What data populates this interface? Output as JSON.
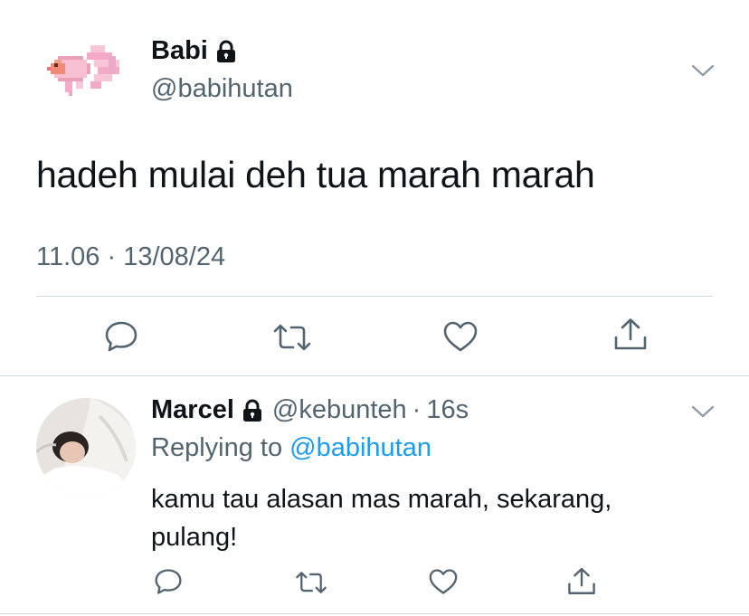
{
  "tweet": {
    "display_name": "Babi",
    "handle": "@babihutan",
    "text": "hadeh mulai deh tua marah marah",
    "timestamp": "11.06 · 13/08/24",
    "avatar_icon": "pixel-betta-fish-icon"
  },
  "reply": {
    "display_name": "Marcel",
    "handle": "@kebunteh",
    "separator": "·",
    "time": "16s",
    "replying_prefix": "Replying to",
    "replying_to": "@babihutan",
    "text": "kamu tau alasan mas marah, sekarang, pulang!"
  },
  "icons": {
    "protected": "lock-icon",
    "menu": "chevron-down-icon",
    "actions": [
      "reply-icon",
      "retweet-icon",
      "like-icon",
      "share-icon"
    ]
  },
  "colors": {
    "text": "#0f1419",
    "secondary": "#536471",
    "link": "#1d9bf0",
    "divider": "#cfd9de"
  }
}
